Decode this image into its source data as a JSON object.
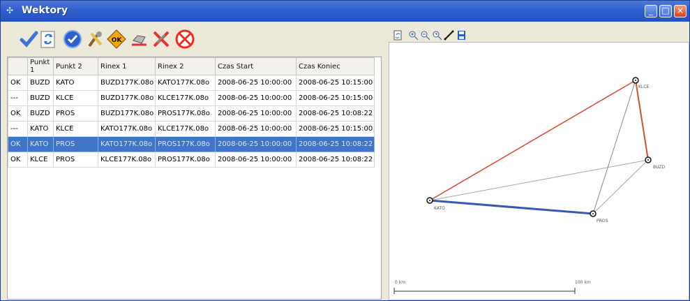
{
  "window": {
    "title": "Wektory"
  },
  "toolbar": {
    "icons": [
      "check-icon",
      "refresh-document-icon",
      "approve-circle-icon",
      "tools-icon",
      "ok-octagon-icon",
      "hand-icon",
      "cross-tools-icon",
      "cancel-circle-icon"
    ]
  },
  "table": {
    "headers": [
      "",
      "Punkt 1",
      "Punkt 2",
      "Rinex 1",
      "Rinex 2",
      "Czas Start",
      "Czas Koniec"
    ],
    "rows": [
      [
        "OK",
        "BUZD",
        "KATO",
        "BUZD177K.08o",
        "KATO177K.08o",
        "2008-06-25 10:00:00",
        "2008-06-25 10:15:00"
      ],
      [
        "---",
        "BUZD",
        "KLCE",
        "BUZD177K.08o",
        "KLCE177K.08o",
        "2008-06-25 10:00:00",
        "2008-06-25 10:15:00"
      ],
      [
        "OK",
        "BUZD",
        "PROS",
        "BUZD177K.08o",
        "PROS177K.08o",
        "2008-06-25 10:00:00",
        "2008-06-25 10:08:22"
      ],
      [
        "---",
        "KATO",
        "KLCE",
        "KATO177K.08o",
        "KLCE177K.08o",
        "2008-06-25 10:00:00",
        "2008-06-25 10:15:00"
      ],
      [
        "OK",
        "KATO",
        "PROS",
        "KATO177K.08o",
        "PROS177K.08o",
        "2008-06-25 10:00:00",
        "2008-06-25 10:08:22"
      ],
      [
        "OK",
        "KLCE",
        "PROS",
        "KLCE177K.08o",
        "PROS177K.08o",
        "2008-06-25 10:00:00",
        "2008-06-25 10:08:22"
      ]
    ],
    "selected_row_index": 4
  },
  "map": {
    "toolbar_icons": [
      "refresh-map-icon",
      "zoom-in-icon",
      "zoom-out-icon",
      "zoom-extent-icon",
      "measure-line-icon",
      "save-icon"
    ],
    "stations": {
      "KLCE": "KLCE",
      "BUZD": "BUZD",
      "KATO": "KATO",
      "PROS": "PROS"
    },
    "scale": {
      "left": "0 km",
      "right": "100 km"
    },
    "colors": {
      "red": "#d84a32",
      "blue": "#375ab1",
      "gray": "#a5a5a5"
    }
  }
}
